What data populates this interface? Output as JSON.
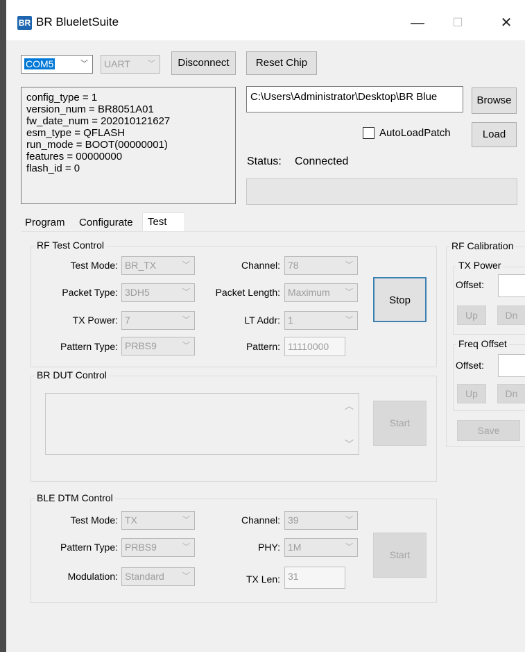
{
  "window": {
    "title": "BR BlueletSuite",
    "icon_text": "BR",
    "minimize": "—",
    "maximize": "☐",
    "close": "✕"
  },
  "toolbar": {
    "port": "COM5",
    "mode": "UART",
    "disconnect": "Disconnect",
    "reset_chip": "Reset Chip"
  },
  "info": {
    "lines": [
      "config_type = 1",
      "version_num = BR8051A01",
      "fw_date_num = 202010121627",
      "esm_type = QFLASH",
      "run_mode = BOOT(00000001)",
      "features = 00000000",
      "flash_id = 0"
    ]
  },
  "patch": {
    "path": "C:\\Users\\Administrator\\Desktop\\BR Blue",
    "browse": "Browse",
    "autoload": "AutoLoadPatch",
    "load": "Load",
    "status_label": "Status:",
    "status_value": "Connected"
  },
  "tabs": [
    "Program",
    "Configurate",
    "Test"
  ],
  "rf_test": {
    "title": "RF Test Control",
    "test_mode_label": "Test Mode:",
    "test_mode": "BR_TX",
    "channel_label": "Channel:",
    "channel": "78",
    "packet_type_label": "Packet Type:",
    "packet_type": "3DH5",
    "packet_length_label": "Packet Length:",
    "packet_length": "Maximum",
    "tx_power_label": "TX Power:",
    "tx_power": "7",
    "lt_addr_label": "LT Addr:",
    "lt_addr": "1",
    "pattern_type_label": "Pattern Type:",
    "pattern_type": "PRBS9",
    "pattern_label": "Pattern:",
    "pattern": "11110000",
    "stop": "Stop"
  },
  "br_dut": {
    "title": "BR DUT Control",
    "start": "Start"
  },
  "ble_dtm": {
    "title": "BLE DTM Control",
    "test_mode_label": "Test Mode:",
    "test_mode": "TX",
    "channel_label": "Channel:",
    "channel": "39",
    "pattern_type_label": "Pattern Type:",
    "pattern_type": "PRBS9",
    "phy_label": "PHY:",
    "phy": "1M",
    "modulation_label": "Modulation:",
    "modulation": "Standard",
    "tx_len_label": "TX Len:",
    "tx_len": "31",
    "start": "Start"
  },
  "rf_cal": {
    "title": "RF Calibration",
    "tx_power": "TX Power",
    "offset_label": "Offset:",
    "up": "Up",
    "dn": "Dn",
    "freq_offset": "Freq Offset",
    "save": "Save"
  }
}
